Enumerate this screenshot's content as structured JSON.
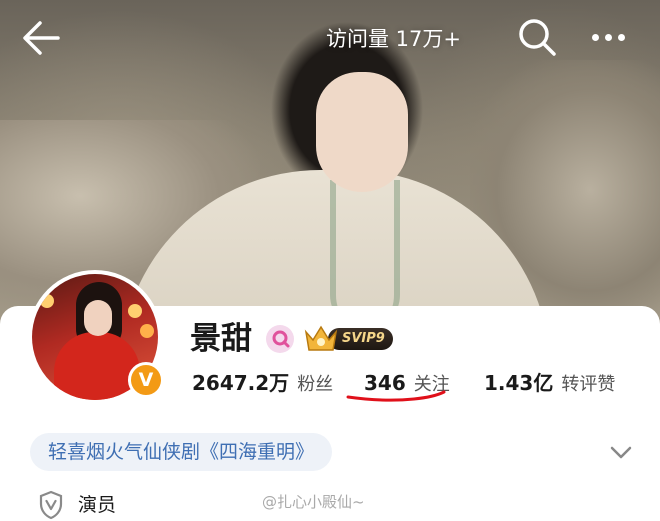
{
  "header": {
    "visits_text": "访问量 17万+",
    "back_icon": "back-arrow-icon",
    "search_icon": "search-icon",
    "more_icon": "more-dots-icon"
  },
  "profile": {
    "name": "景甜",
    "gender_icon": "female-icon",
    "vip_label": "SVIP9",
    "verified_badge": "V",
    "stats": [
      {
        "value": "2647.2万",
        "label": "粉丝"
      },
      {
        "value": "346",
        "label": "关注"
      },
      {
        "value": "1.43亿",
        "label": "转评赞"
      }
    ],
    "tag": "轻喜烟火气仙侠剧《四海重明》",
    "verification": "演员"
  },
  "watermark": "@扎心小殿仙~",
  "colors": {
    "accent_blue": "#3f6fb3",
    "vip_gold": "#f5d68a",
    "verified_orange": "#f39a15",
    "annotation_red": "#e0101a"
  }
}
